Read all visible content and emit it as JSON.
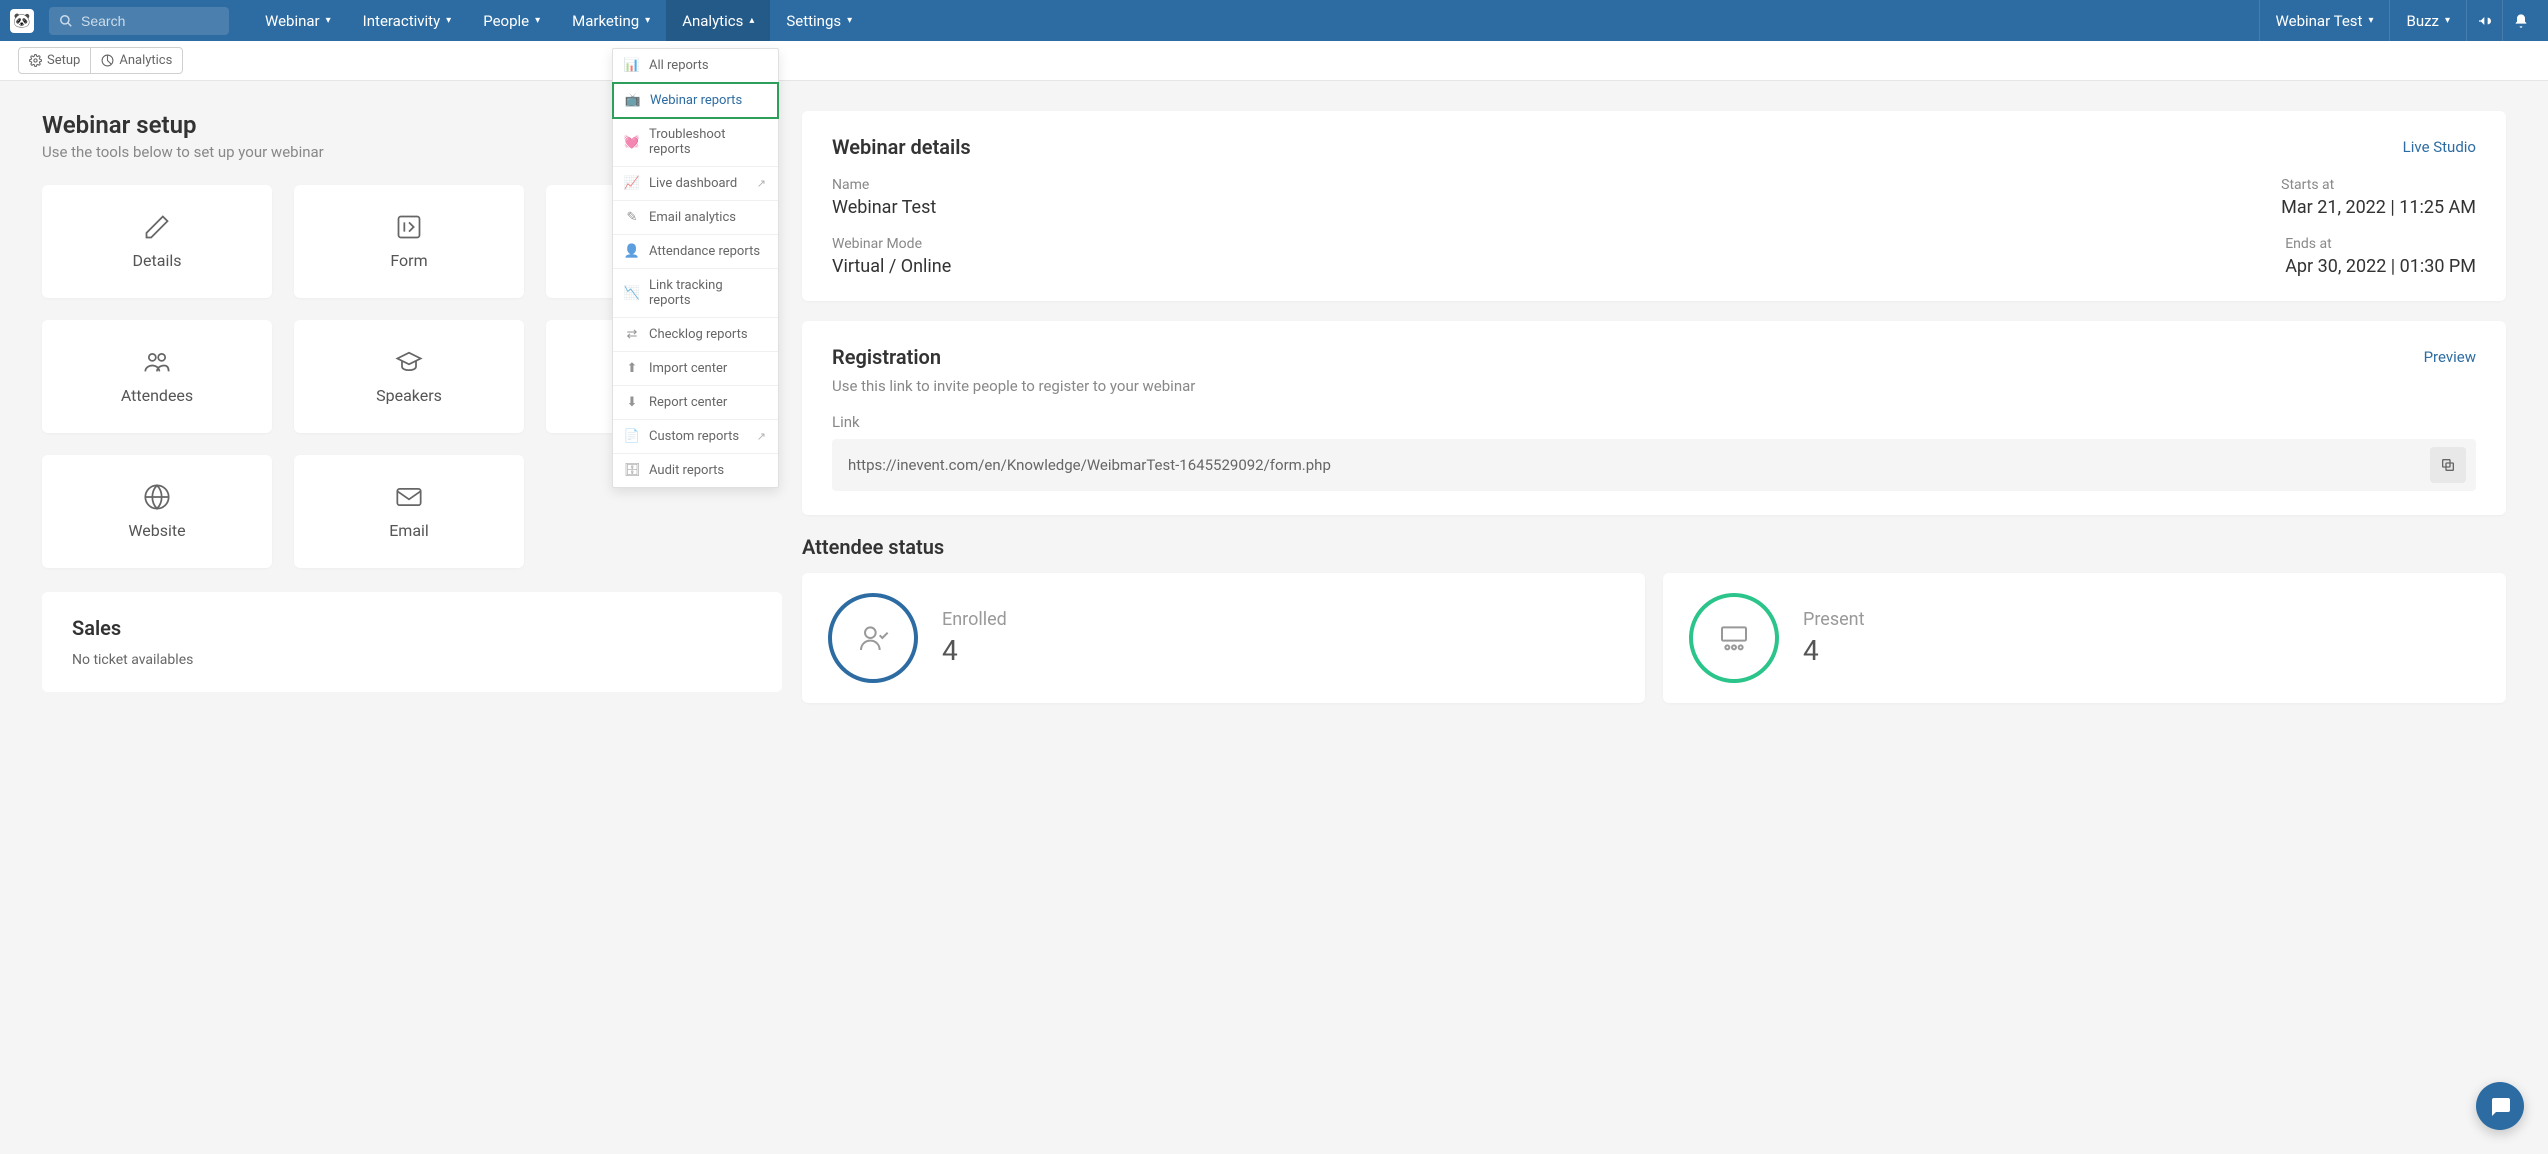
{
  "search": {
    "placeholder": "Search"
  },
  "nav": {
    "webinar": "Webinar",
    "interactivity": "Interactivity",
    "people": "People",
    "marketing": "Marketing",
    "analytics": "Analytics",
    "settings": "Settings"
  },
  "top_right": {
    "webinar_test": "Webinar Test",
    "buzz": "Buzz"
  },
  "subnav": {
    "setup": "Setup",
    "analytics": "Analytics"
  },
  "dropdown": {
    "all_reports": "All reports",
    "webinar_reports": "Webinar reports",
    "troubleshoot": "Troubleshoot reports",
    "live_dashboard": "Live dashboard",
    "email_analytics": "Email analytics",
    "attendance": "Attendance reports",
    "link_tracking": "Link tracking reports",
    "checklog": "Checklog reports",
    "import": "Import center",
    "report_center": "Report center",
    "custom": "Custom reports",
    "audit": "Audit reports"
  },
  "page": {
    "title": "Webinar setup",
    "subtitle": "Use the tools below to set up your webinar"
  },
  "tiles": {
    "details": "Details",
    "form": "Form",
    "attendees": "Attendees",
    "speakers": "Speakers",
    "website": "Website",
    "email": "Email"
  },
  "sales": {
    "title": "Sales",
    "empty": "No ticket availables"
  },
  "details_panel": {
    "title": "Webinar details",
    "live_studio": "Live Studio",
    "name_label": "Name",
    "name_value": "Webinar Test",
    "starts_label": "Starts at",
    "starts_value": "Mar 21, 2022 | 11:25 AM",
    "mode_label": "Webinar Mode",
    "mode_value": "Virtual / Online",
    "ends_label": "Ends at",
    "ends_value": "Apr 30, 2022 | 01:30 PM"
  },
  "registration": {
    "title": "Registration",
    "preview": "Preview",
    "subtitle": "Use this link to invite people to register to your webinar",
    "link_label": "Link",
    "link_value": "https://inevent.com/en/Knowledge/WeibmarTest-1645529092/form.php"
  },
  "attendee_status": {
    "title": "Attendee status",
    "enrolled_label": "Enrolled",
    "enrolled_value": "4",
    "present_label": "Present",
    "present_value": "4"
  }
}
